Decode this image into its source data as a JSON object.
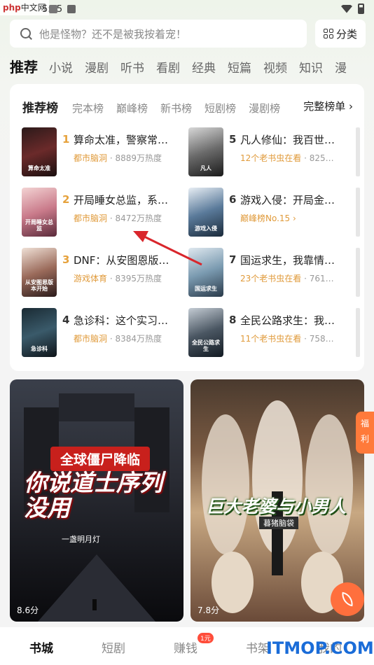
{
  "status_bar": {
    "time": "5:25"
  },
  "watermark": {
    "php": "php",
    "cn": "中文网"
  },
  "search": {
    "placeholder": "他是怪物？还不是被我按着宠！"
  },
  "category_button": {
    "label": "分类"
  },
  "tabs": [
    {
      "label": "推荐",
      "active": true
    },
    {
      "label": "小说"
    },
    {
      "label": "漫剧"
    },
    {
      "label": "听书"
    },
    {
      "label": "看剧"
    },
    {
      "label": "经典"
    },
    {
      "label": "短篇"
    },
    {
      "label": "视频"
    },
    {
      "label": "知识"
    },
    {
      "label": "漫"
    }
  ],
  "ranking": {
    "tabs": [
      {
        "label": "推荐榜",
        "active": true
      },
      {
        "label": "完本榜"
      },
      {
        "label": "巅峰榜"
      },
      {
        "label": "新书榜"
      },
      {
        "label": "短剧榜"
      },
      {
        "label": "漫剧榜"
      }
    ],
    "more": "完整榜单 ›",
    "books": [
      {
        "num": "1",
        "title": "算命太准，警察常…",
        "tag": "都市脑洞",
        "heat": "· 8889万热度",
        "cover": "算命太准"
      },
      {
        "num": "2",
        "title": "开局睡女总监，系…",
        "tag": "都市脑洞",
        "heat": "· 8472万热度",
        "cover": "开局睡女总监"
      },
      {
        "num": "3",
        "title": "DNF：从安图恩版…",
        "tag": "游戏体育",
        "heat": "· 8395万热度",
        "cover": "从安图恩版本开始"
      },
      {
        "num": "4",
        "title": "急诊科：这个实习…",
        "tag": "都市脑洞",
        "heat": "· 8384万热度",
        "cover": "急诊科"
      },
      {
        "num": "5",
        "title": "凡人修仙：我百世…",
        "tag": "12个老书虫在看",
        "heat": "· 825…",
        "cover": "凡人"
      },
      {
        "num": "6",
        "title": "游戏入侵：开局金…",
        "tag": "巅峰榜No.15 ›",
        "heat": "",
        "cover": "游戏入侵"
      },
      {
        "num": "7",
        "title": "国运求生，我靠情…",
        "tag": "23个老书虫在看",
        "heat": "· 761…",
        "cover": "国运求生"
      },
      {
        "num": "8",
        "title": "全民公路求生：我…",
        "tag": "11个老书虫在看",
        "heat": "· 758…",
        "cover": "全民公路求生"
      }
    ]
  },
  "feed": [
    {
      "top": "全球僵尸降临",
      "main": "你说道士序列没用",
      "author": "一盏明月灯",
      "score": "8.6分"
    },
    {
      "title": "巨大老婆与小男人",
      "sub": "暮猪脑袋",
      "score": "7.8分"
    }
  ],
  "benefit": "福利",
  "bottom_nav": [
    {
      "label": "书城",
      "active": true
    },
    {
      "label": "短剧"
    },
    {
      "label": "赚钱",
      "badge": "1元"
    },
    {
      "label": "书架"
    },
    {
      "label": "我的"
    }
  ],
  "site_watermark": "ITMOP.COM",
  "colors": {
    "accent": "#e6a23c",
    "tag": "#e09a3a",
    "fab": "#ff6f3d",
    "arrow": "#d9262c"
  }
}
